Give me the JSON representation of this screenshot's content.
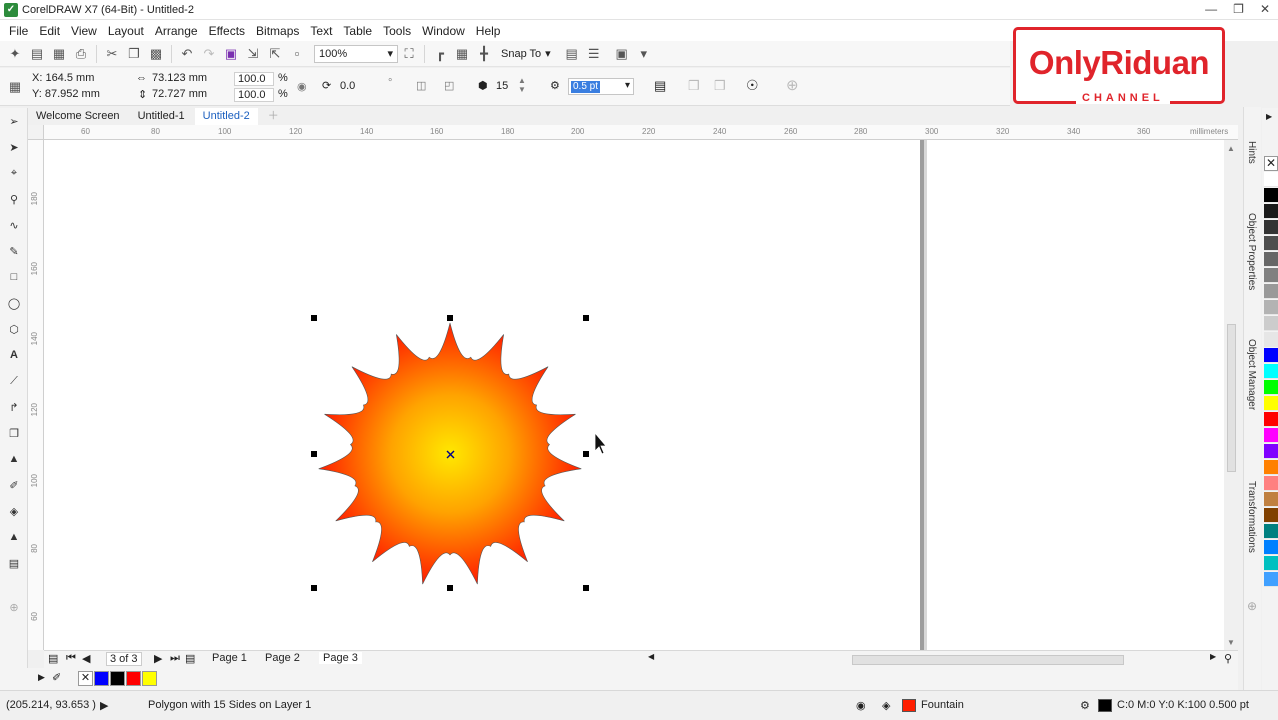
{
  "window": {
    "title": "CorelDRAW X7 (64-Bit) - Untitled-2",
    "app_icon": "coreldraw-icon",
    "controls": [
      "minimize-icon",
      "restore-icon",
      "close-icon"
    ]
  },
  "menu": [
    "File",
    "Edit",
    "View",
    "Layout",
    "Arrange",
    "Effects",
    "Bitmaps",
    "Text",
    "Table",
    "Tools",
    "Window",
    "Help"
  ],
  "toolbar": {
    "zoom": "100%",
    "snap_to": "Snap To"
  },
  "property_bar": {
    "x": "X: 164.5 mm",
    "y": "Y: 87.952 mm",
    "width": "73.123 mm",
    "height": "72.727 mm",
    "scale_x": "100.0",
    "scale_y": "100.0",
    "pct": "%",
    "rotation": "0.0",
    "degree": "°",
    "sides": "15",
    "outline_width": "0.5 pt"
  },
  "logo": {
    "name": "OnlyRiduan",
    "tagline": "CHANNEL"
  },
  "tabs": [
    "Welcome Screen",
    "Untitled-1",
    "Untitled-2"
  ],
  "active_tab": "Untitled-2",
  "ruler": {
    "h_labels": [
      "60",
      "80",
      "100",
      "120",
      "140",
      "160",
      "180",
      "200",
      "220",
      "240",
      "260",
      "280",
      "300",
      "320",
      "340",
      "360"
    ],
    "h_unit": "millimeters",
    "v_labels": [
      "180",
      "160",
      "140",
      "120",
      "100",
      "80",
      "60"
    ],
    "v_unit": "millimeters"
  },
  "dockers": [
    "Hints",
    "Object Properties",
    "Object Manager",
    "Transformations"
  ],
  "page_nav": {
    "counter": "3 of 3",
    "pages": [
      "Page 1",
      "Page 2",
      "Page 3"
    ],
    "active_page": "Page 3"
  },
  "status": {
    "coords": "(205.214, 93.653 )",
    "object_info": "Polygon with 15 Sides on Layer 1",
    "fill": "Fountain",
    "outline": "C:0 M:0 Y:0 K:100  0.500 pt"
  },
  "colors": {
    "accent": "#1b5fbf",
    "brand_red": "#e0242b",
    "fill_center": "#ffe000",
    "fill_edge": "#ff1a00"
  },
  "palette": [
    "#ffffff",
    "#000000",
    "#1a1a1a",
    "#333333",
    "#4d4d4d",
    "#666666",
    "#808080",
    "#999999",
    "#b3b3b3",
    "#cccccc",
    "#e6e6e6",
    "#0000ff",
    "#00ffff",
    "#00ff00",
    "#ffff00",
    "#ff0000",
    "#ff00ff",
    "#8000ff",
    "#ff8000",
    "#ff8080",
    "#c08040",
    "#804000",
    "#008080",
    "#0080ff",
    "#00c0c0",
    "#40a0ff"
  ],
  "document_palette": [
    "#0000ff",
    "#000000",
    "#ff0000",
    "#ffff00"
  ]
}
